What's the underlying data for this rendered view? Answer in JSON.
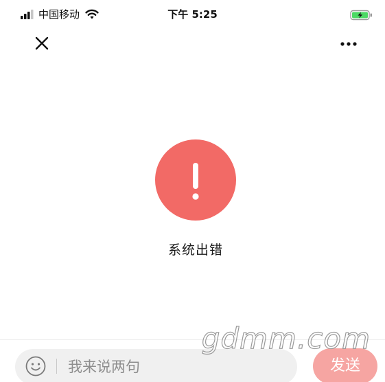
{
  "status_bar": {
    "carrier": "中国移动",
    "time": "下午 5:25",
    "signal_icon": "signal-icon",
    "wifi_icon": "wifi-icon",
    "battery_icon": "battery-charging-icon",
    "battery_color": "#4cd964"
  },
  "nav": {
    "close_icon": "close-icon",
    "more_icon": "more-icon"
  },
  "error": {
    "icon": "exclamation-icon",
    "color": "#f26a66",
    "title": "系统出错"
  },
  "input_bar": {
    "emoji_icon": "emoji-icon",
    "placeholder": "我来说两句",
    "value": ""
  },
  "send_button": {
    "label": "发送",
    "color": "#f6a5a2"
  },
  "watermark": {
    "text": "gdmm.com"
  }
}
